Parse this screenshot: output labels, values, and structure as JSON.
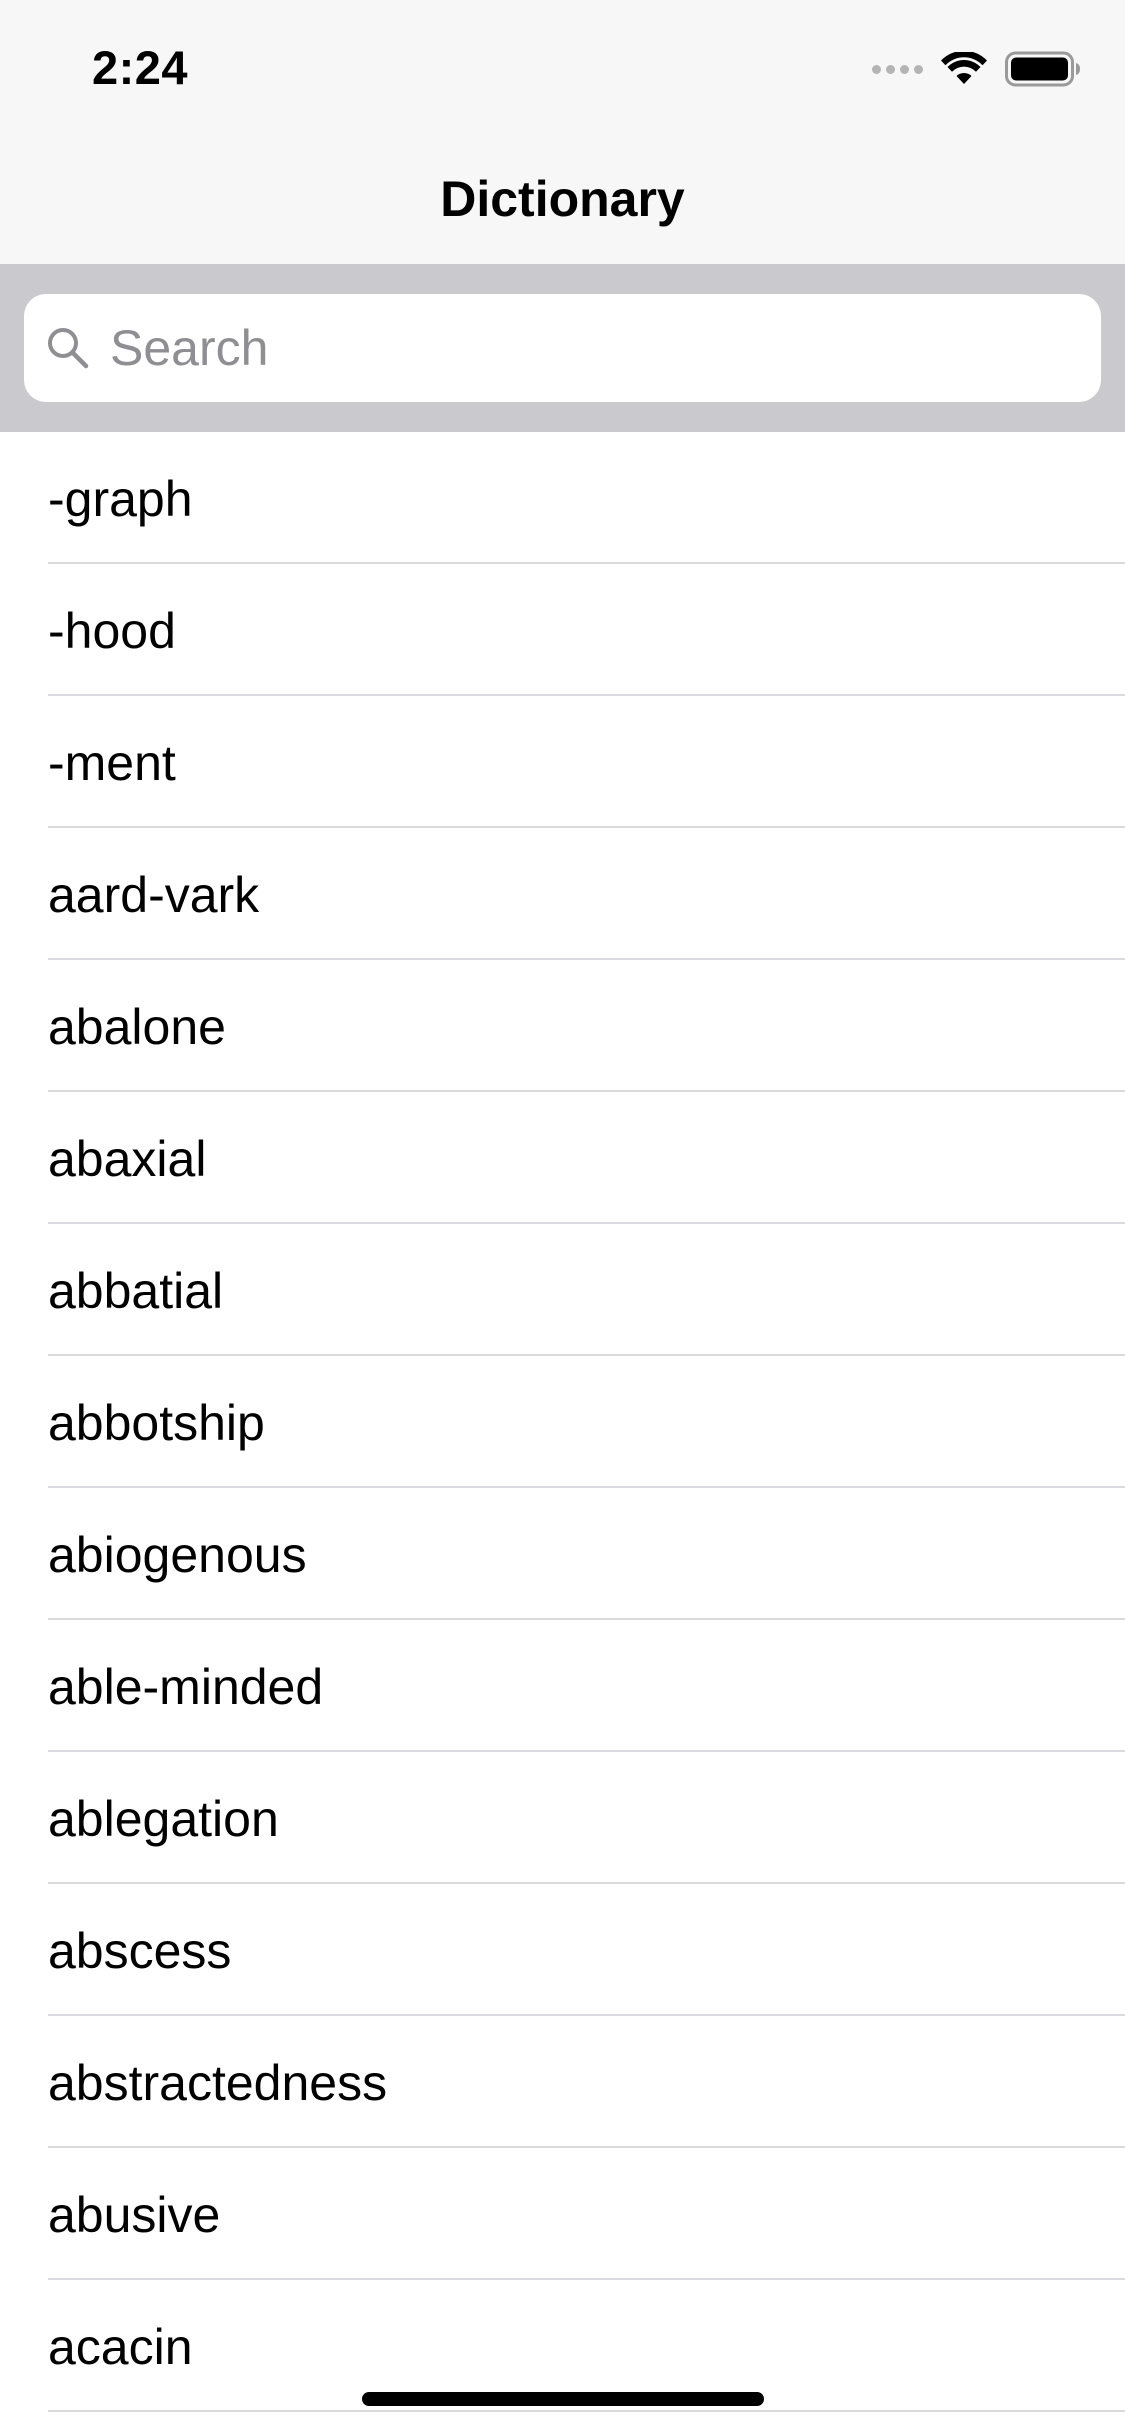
{
  "status_bar": {
    "time": "2:24",
    "icons": [
      "cellular-signal-icon",
      "wifi-icon",
      "battery-icon"
    ]
  },
  "nav": {
    "title": "Dictionary"
  },
  "search": {
    "placeholder": "Search",
    "icon": "search-icon"
  },
  "words": [
    "-graph",
    "-hood",
    "-ment",
    "aard-vark",
    "abalone",
    "abaxial",
    "abbatial",
    "abbotship",
    "abiogenous",
    "able-minded",
    "ablegation",
    "abscess",
    "abstractedness",
    "abusive",
    "acacin"
  ],
  "colors": {
    "bar_background": "#f7f7f7",
    "search_area_background": "#c9c9ce",
    "placeholder": "#8e8e93",
    "separator": "#d9d9de"
  }
}
